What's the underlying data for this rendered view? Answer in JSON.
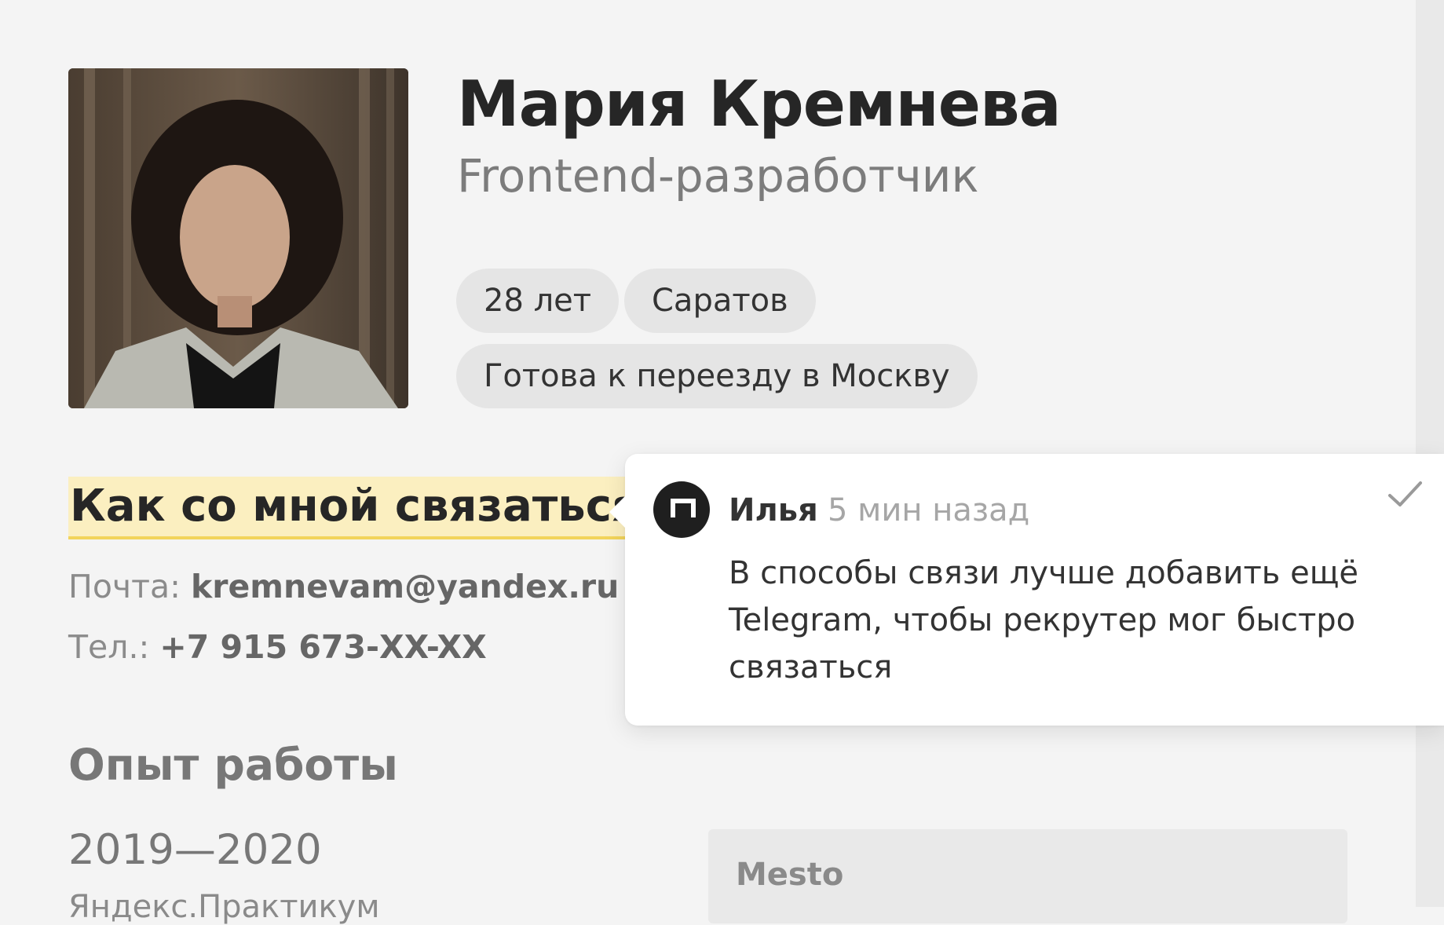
{
  "profile": {
    "name": "Мария Кремнева",
    "role": "Frontend-разработчик",
    "tags": [
      "28 лет",
      "Саратов",
      "Готова к переезду в Москву"
    ]
  },
  "contacts": {
    "heading": "Как со мной связаться",
    "email_label": "Почта:",
    "email_value": "kremnevam@yandex.ru",
    "phone_label": "Тел.:",
    "phone_value": "+7 915 673-XX-XX"
  },
  "experience": {
    "heading": "Опыт работы",
    "years": "2019—2020",
    "company": "Яндекс.Практикум",
    "project": "Mesto"
  },
  "comment": {
    "author": "Илья",
    "time": "5 мин назад",
    "text": "В способы связи лучше добавить ещё Telegram, чтобы рекрутер мог быстро связаться",
    "resolve_icon": "check-icon",
    "avatar_icon": "practicum-logo-icon"
  }
}
